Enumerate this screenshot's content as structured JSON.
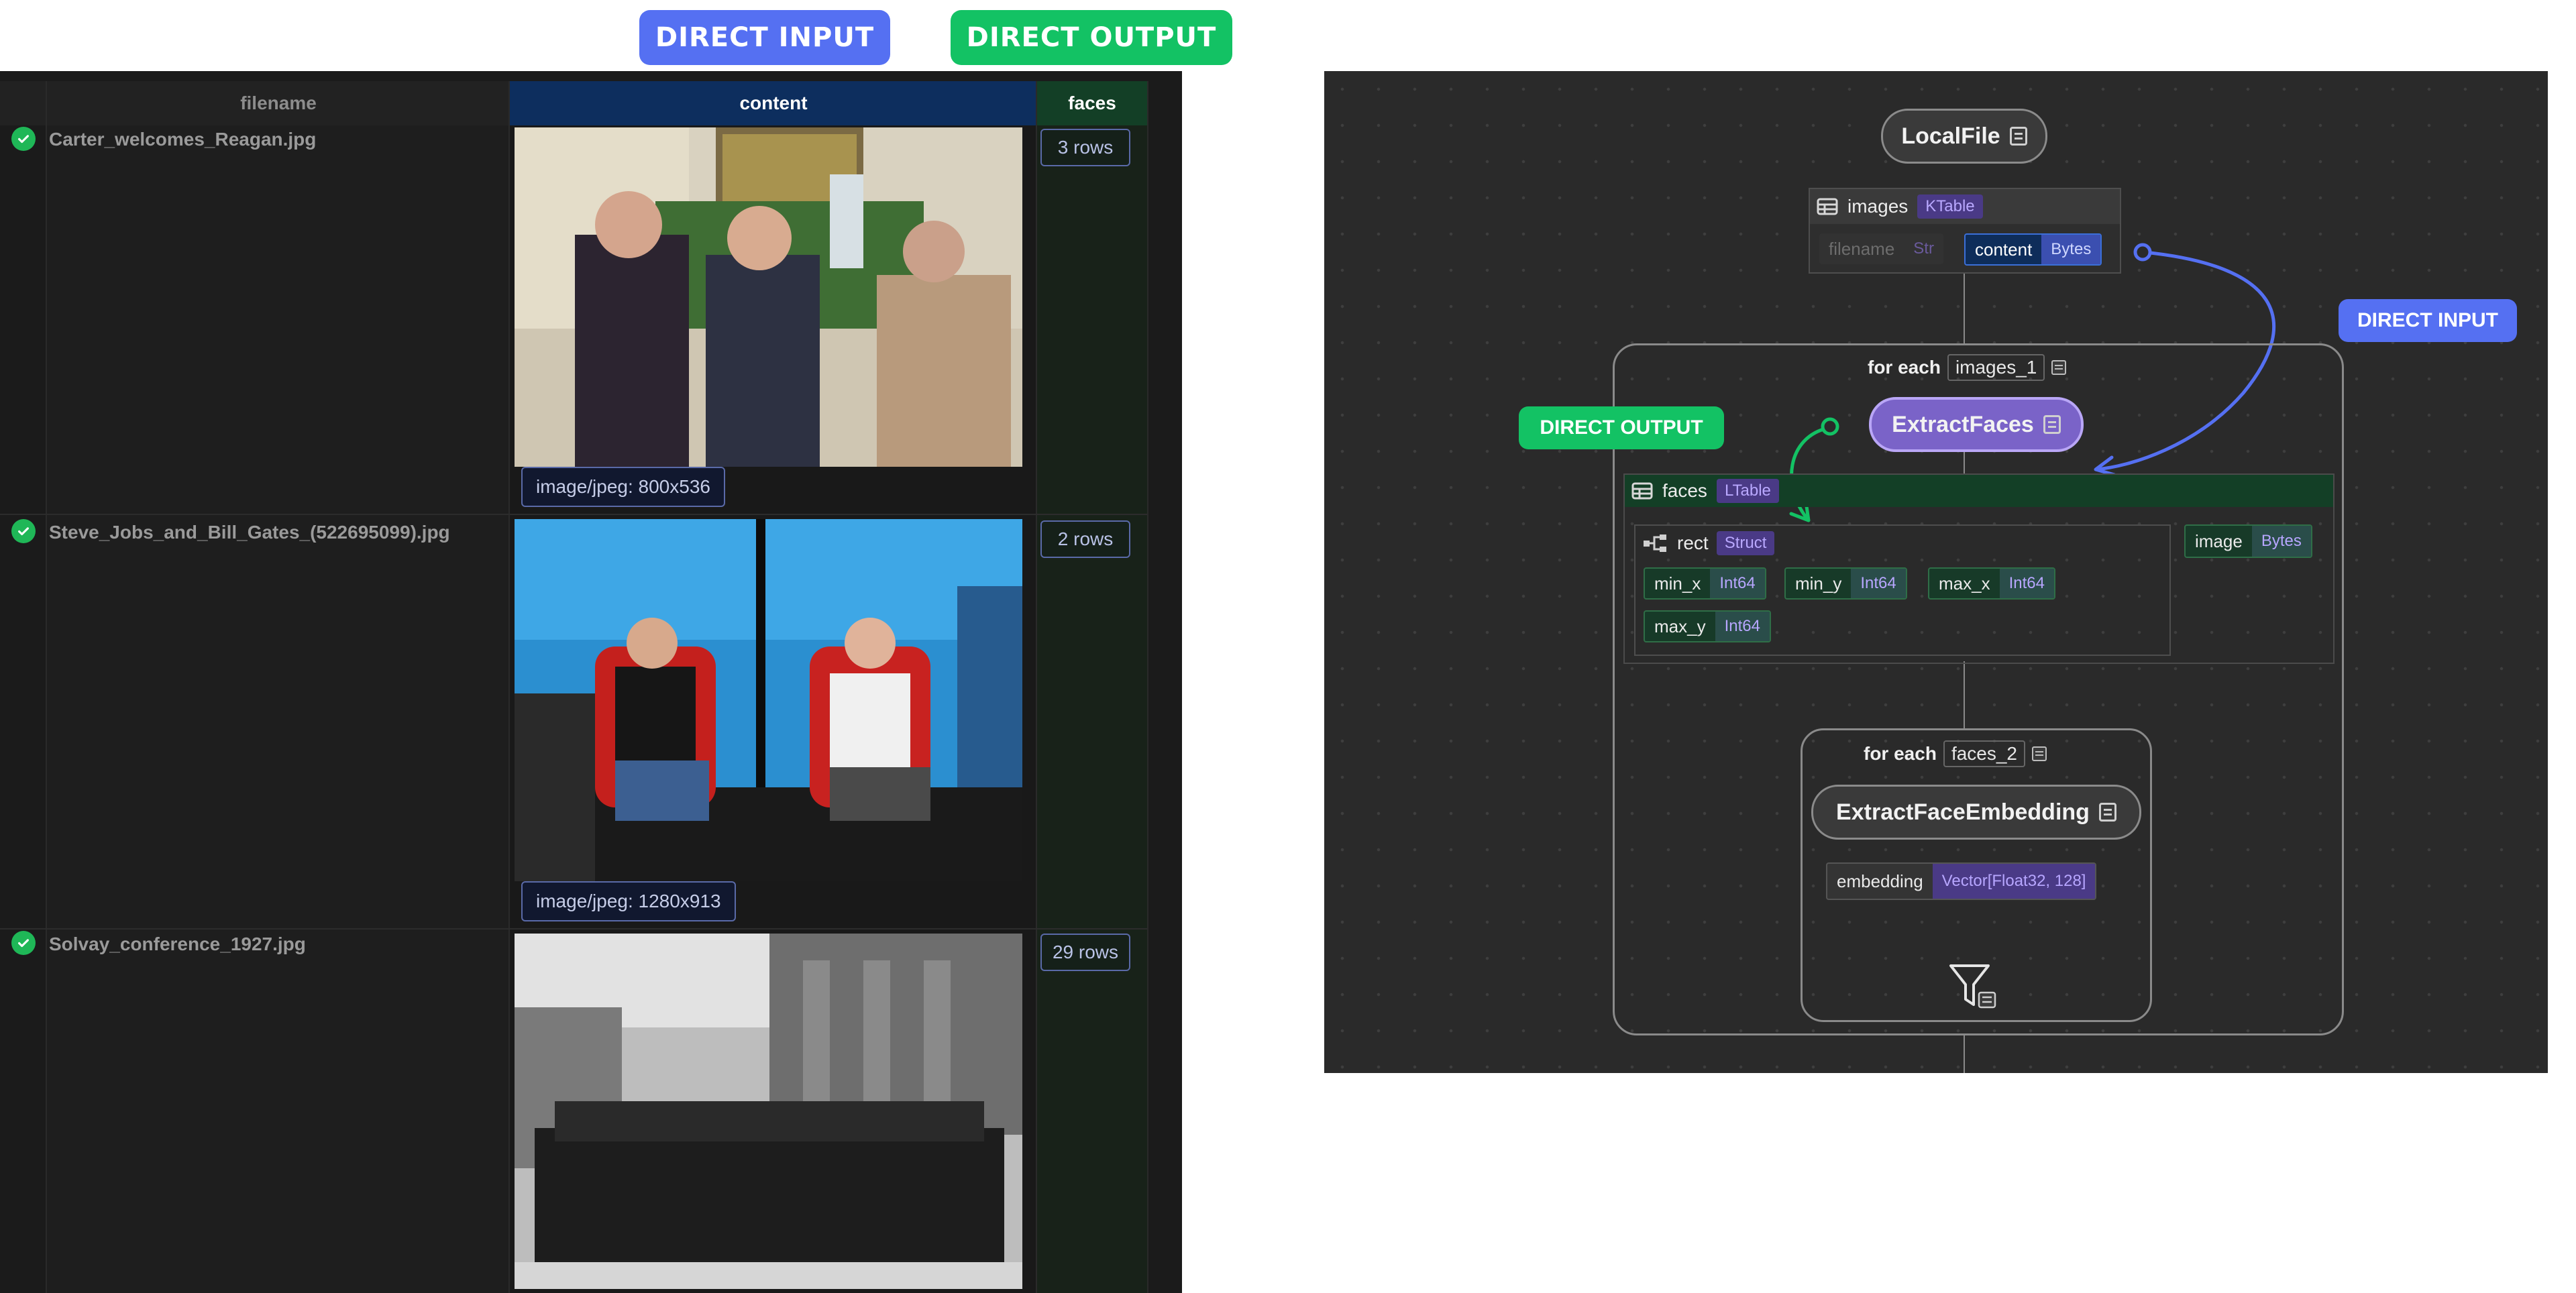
{
  "badges": {
    "direct_input": "DIRECT INPUT",
    "direct_output": "DIRECT OUTPUT"
  },
  "table": {
    "columns": [
      "filename",
      "content",
      "faces"
    ],
    "rows": [
      {
        "filename": "Carter_welcomes_Reagan.jpg",
        "mime": "image/jpeg: 800x536",
        "faces": "3 rows"
      },
      {
        "filename": "Steve_Jobs_and_Bill_Gates_(522695099).jpg",
        "mime": "image/jpeg: 1280x913",
        "faces": "2 rows"
      },
      {
        "filename": "Solvay_conference_1927.jpg",
        "mime": "",
        "faces": "29 rows"
      }
    ]
  },
  "diagram": {
    "source_node": "LocalFile",
    "images_table": {
      "name": "images",
      "type": "KTable",
      "fields": [
        {
          "name": "filename",
          "type": "Str"
        },
        {
          "name": "content",
          "type": "Bytes"
        }
      ]
    },
    "for_each_1": {
      "label": "for each",
      "var": "images_1"
    },
    "extract_faces": "ExtractFaces",
    "faces_table": {
      "name": "faces",
      "type": "LTable"
    },
    "rect": {
      "name": "rect",
      "type": "Struct",
      "fields": [
        {
          "name": "min_x",
          "type": "Int64"
        },
        {
          "name": "min_y",
          "type": "Int64"
        },
        {
          "name": "max_x",
          "type": "Int64"
        },
        {
          "name": "max_y",
          "type": "Int64"
        }
      ]
    },
    "image_field": {
      "name": "image",
      "type": "Bytes"
    },
    "for_each_2": {
      "label": "for each",
      "var": "faces_2"
    },
    "extract_embedding": "ExtractFaceEmbedding",
    "embedding": {
      "name": "embedding",
      "type": "Vector[Float32, 128]"
    },
    "direct_input_label": "DIRECT INPUT",
    "direct_output_label": "DIRECT OUTPUT"
  },
  "colors": {
    "blue_accent": "#5570f2",
    "green_accent": "#13c264",
    "purple_node": "#7a63c8",
    "header_blue": "#0d2e5e",
    "header_green": "#133f26"
  },
  "icons": [
    "check-icon",
    "document-icon",
    "table-icon",
    "struct-icon",
    "filter-icon"
  ]
}
